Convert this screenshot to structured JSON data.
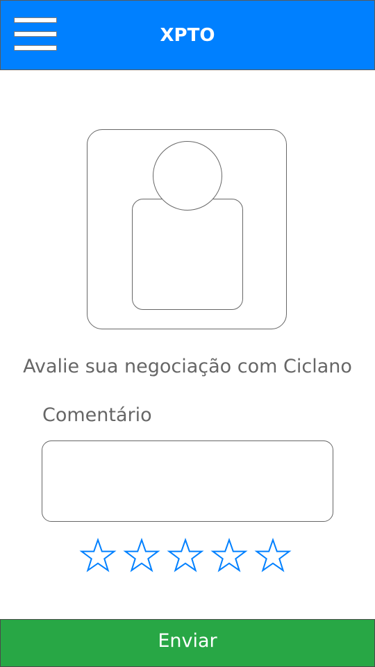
{
  "header": {
    "title": "XPTO",
    "background": "#0080ff",
    "menu_icon": "hamburger-menu-icon"
  },
  "profile": {
    "avatar_icon": "user-placeholder-icon"
  },
  "rating": {
    "prompt": "Avalie sua negociação com Ciclano",
    "comment_label": "Comentário",
    "comment_value": "",
    "stars_total": 5,
    "stars_selected": 0,
    "star_icon": "star-outline-icon",
    "star_color": "#0080ff"
  },
  "footer": {
    "submit_label": "Enviar",
    "submit_color": "#28a745"
  }
}
